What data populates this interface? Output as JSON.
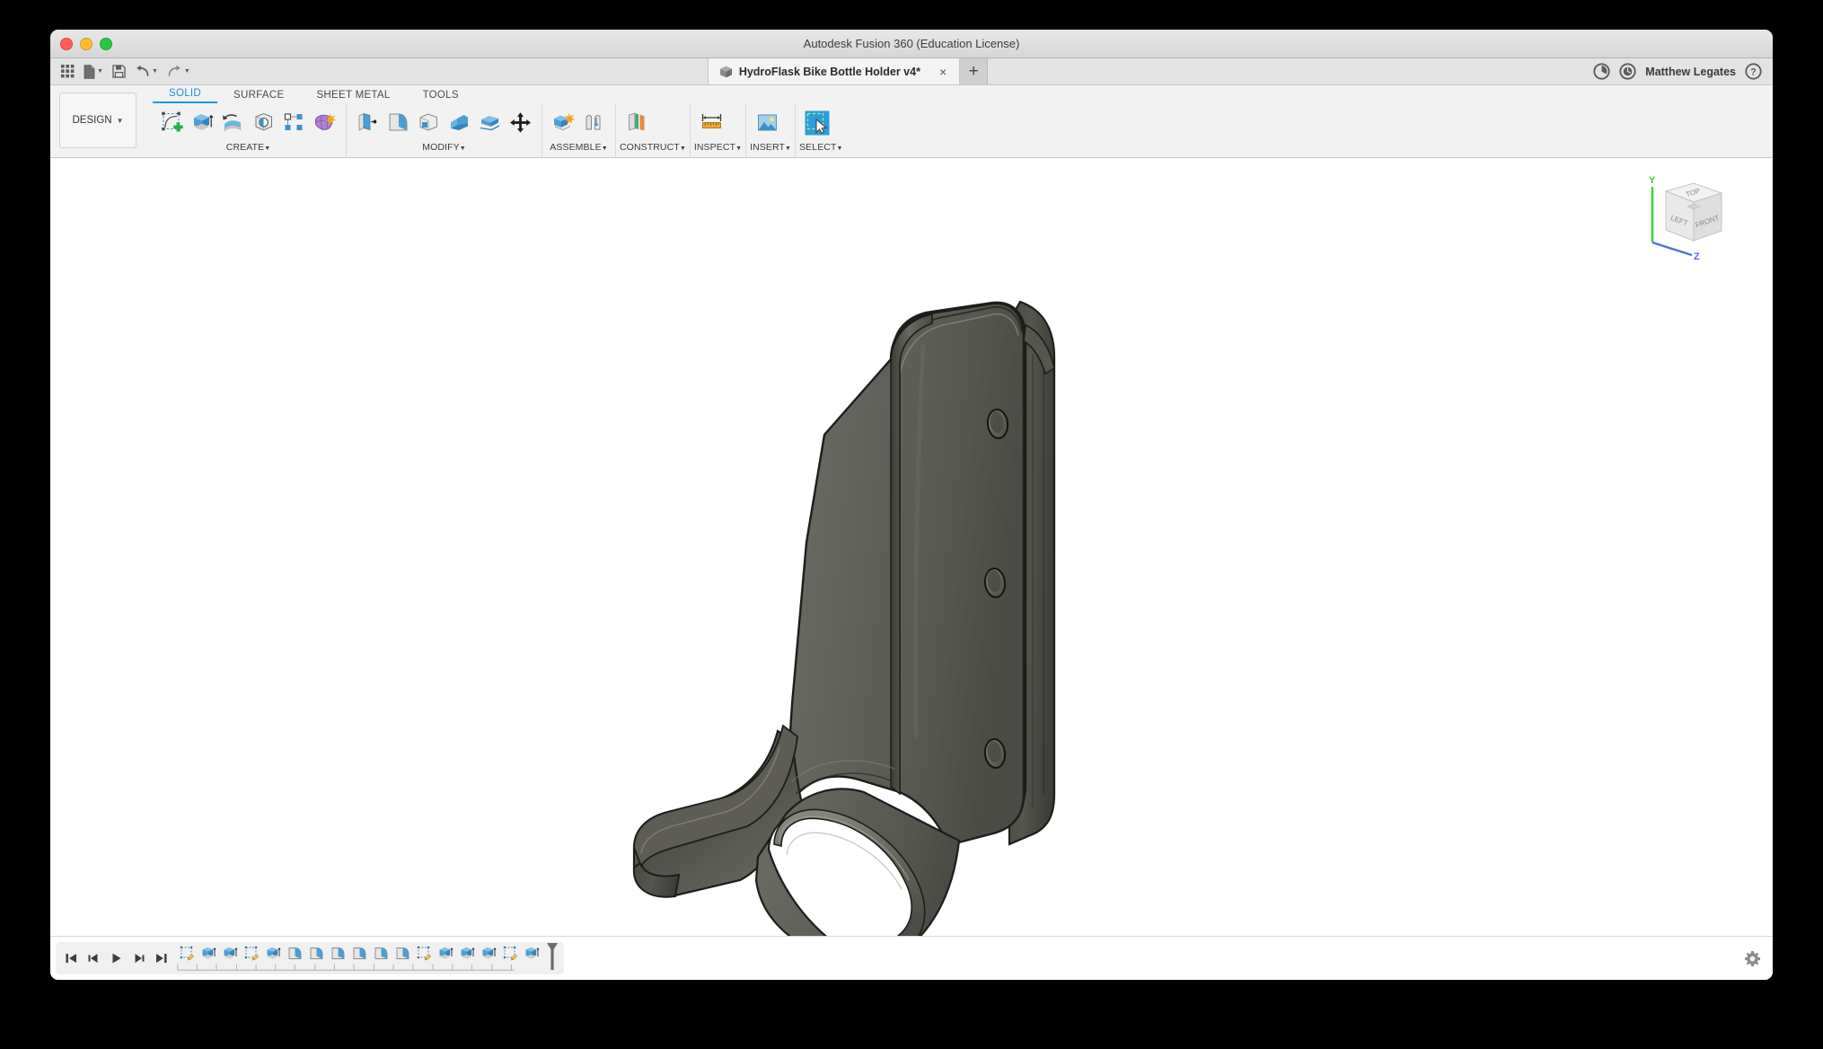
{
  "window": {
    "title": "Autodesk Fusion 360 (Education License)",
    "traffic_lights": [
      "close",
      "minimize",
      "maximize"
    ]
  },
  "quick_access": {
    "buttons": [
      {
        "name": "show-data-panel",
        "icon": "grid-icon",
        "label": "Show Data Panel",
        "caret": false
      },
      {
        "name": "file-menu",
        "icon": "file-icon",
        "label": "File",
        "caret": true
      },
      {
        "name": "save-button",
        "icon": "save-icon",
        "label": "Save",
        "caret": false
      },
      {
        "name": "undo-button",
        "icon": "undo-arrow-icon",
        "label": "Undo",
        "caret": true
      },
      {
        "name": "redo-button",
        "icon": "redo-arrow-icon",
        "label": "Redo",
        "caret": true
      }
    ],
    "document_tab": {
      "label": "HydroFlask Bike Bottle Holder v4*",
      "icon": "cube-document-icon",
      "close_label": "×"
    },
    "new_tab_label": "+",
    "right_icons": [
      {
        "name": "job-status-icon",
        "label": "Job Status"
      },
      {
        "name": "extensions-clock-icon",
        "label": "Extensions"
      }
    ],
    "user_name": "Matthew Legates",
    "help_label": "Help"
  },
  "ribbon": {
    "workspace_label": "DESIGN",
    "workspace_caret": "▾",
    "tabs": [
      {
        "label": "SOLID",
        "active": true
      },
      {
        "label": "SURFACE",
        "active": false
      },
      {
        "label": "SHEET METAL",
        "active": false
      },
      {
        "label": "TOOLS",
        "active": false
      }
    ],
    "groups": [
      {
        "label": "CREATE",
        "caret": "▾",
        "items": [
          {
            "name": "create-sketch-button",
            "icon": "create-sketch-icon"
          },
          {
            "name": "extrude-button",
            "icon": "extrude-icon"
          },
          {
            "name": "revolve-button",
            "icon": "revolve-icon"
          },
          {
            "name": "hole-button",
            "icon": "hole-icon"
          },
          {
            "name": "rectangular-pattern-button",
            "icon": "rectangular-pattern-icon"
          },
          {
            "name": "create-form-button",
            "icon": "create-form-icon"
          }
        ]
      },
      {
        "label": "MODIFY",
        "caret": "▾",
        "items": [
          {
            "name": "press-pull-button",
            "icon": "press-pull-icon"
          },
          {
            "name": "fillet-button",
            "icon": "fillet-icon"
          },
          {
            "name": "shell-button",
            "icon": "shell-icon"
          },
          {
            "name": "draft-button",
            "icon": "draft-icon"
          },
          {
            "name": "scale-button",
            "icon": "scale-icon"
          },
          {
            "name": "move-copy-button",
            "icon": "move-copy-icon"
          }
        ]
      },
      {
        "label": "ASSEMBLE",
        "caret": "▾",
        "items": [
          {
            "name": "new-component-button",
            "icon": "new-component-icon"
          },
          {
            "name": "joint-button",
            "icon": "joint-icon"
          }
        ]
      },
      {
        "label": "CONSTRUCT",
        "caret": "▾",
        "items": [
          {
            "name": "offset-plane-button",
            "icon": "offset-plane-icon"
          }
        ]
      },
      {
        "label": "INSPECT",
        "caret": "▾",
        "items": [
          {
            "name": "measure-button",
            "icon": "measure-ruler-icon"
          }
        ]
      },
      {
        "label": "INSERT",
        "caret": "▾",
        "items": [
          {
            "name": "insert-image-button",
            "icon": "insert-image-icon"
          }
        ]
      },
      {
        "label": "SELECT",
        "caret": "▾",
        "items": [
          {
            "name": "select-button",
            "icon": "select-cursor-icon"
          }
        ]
      }
    ]
  },
  "viewcube": {
    "faces": {
      "top": "TOP",
      "left": "LEFT",
      "front": "FRONT"
    },
    "axes": [
      {
        "label": "Y",
        "color": "#39d339"
      },
      {
        "label": "Z",
        "color": "#4a6fe0"
      }
    ]
  },
  "model": {
    "name": "hydroflask-bike-bottle-holder",
    "body_color": "#5c5c57",
    "edge_color": "#1c1c1a",
    "highlight_color": "#8f8f88",
    "mount_holes": 3
  },
  "timeline": {
    "playback": [
      {
        "name": "go-to-beginning-button",
        "icon": "skip-start-icon"
      },
      {
        "name": "step-back-button",
        "icon": "step-back-icon"
      },
      {
        "name": "play-button",
        "icon": "play-icon"
      },
      {
        "name": "step-forward-button",
        "icon": "step-forward-icon"
      },
      {
        "name": "go-to-end-button",
        "icon": "skip-end-icon"
      }
    ],
    "features": [
      {
        "name": "timeline-feature-sketch",
        "type": "sketch"
      },
      {
        "name": "timeline-feature-extrude",
        "type": "extrude"
      },
      {
        "name": "timeline-feature-extrude",
        "type": "extrude"
      },
      {
        "name": "timeline-feature-sketch",
        "type": "sketch"
      },
      {
        "name": "timeline-feature-extrude",
        "type": "extrude"
      },
      {
        "name": "timeline-feature-fillet",
        "type": "fillet"
      },
      {
        "name": "timeline-feature-fillet",
        "type": "fillet"
      },
      {
        "name": "timeline-feature-fillet",
        "type": "fillet"
      },
      {
        "name": "timeline-feature-fillet",
        "type": "fillet"
      },
      {
        "name": "timeline-feature-fillet",
        "type": "fillet"
      },
      {
        "name": "timeline-feature-fillet",
        "type": "fillet"
      },
      {
        "name": "timeline-feature-sketch",
        "type": "sketch"
      },
      {
        "name": "timeline-feature-extrude",
        "type": "extrude"
      },
      {
        "name": "timeline-feature-extrude",
        "type": "extrude"
      },
      {
        "name": "timeline-feature-extrude",
        "type": "extrude"
      },
      {
        "name": "timeline-feature-sketch",
        "type": "sketch"
      },
      {
        "name": "timeline-feature-extrude",
        "type": "extrude"
      }
    ],
    "end_marker_label": "End of timeline marker",
    "settings_label": "Timeline settings"
  }
}
